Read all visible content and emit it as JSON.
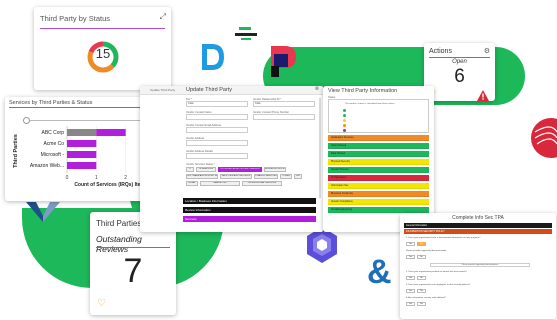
{
  "colors": {
    "brand_green": "#1cb85a",
    "accent_purple": "#b21fdc",
    "rule_purple": "#a64dd9",
    "heart_orange": "#e8a227",
    "warn_red": "#d9283b"
  },
  "status_card": {
    "title": "Third Party by Status",
    "count": "15",
    "expand_icon": "expand-icon"
  },
  "services_card": {
    "title": "Services by Third Parties & Status",
    "chart_data": {
      "type": "bar",
      "orientation": "horizontal",
      "categories": [
        "ABC Corp",
        "Acme Co",
        "Microsoft -",
        "Amazon Web..."
      ],
      "series": [
        {
          "values": [
            1,
            0,
            0,
            0
          ],
          "color": "#888888"
        },
        {
          "values": [
            1,
            1,
            1,
            1
          ],
          "color": "#b21fdc"
        }
      ],
      "xlabel": "Count of Services (IRQs) Items",
      "ylabel": "Third Parties",
      "xticks": [
        "0",
        "1",
        "2",
        "3"
      ],
      "xlim": [
        0,
        3
      ]
    }
  },
  "reviews_card": {
    "title": "Third Parties",
    "subtitle": "Outstanding Reviews",
    "count": "7"
  },
  "actions_card": {
    "title": "Actions",
    "subtitle": "Open",
    "count": "6"
  },
  "form_window": {
    "crumb": "Update Third Party",
    "title": "Update Third Party",
    "fields": [
      {
        "label": "Tier *",
        "value": "Core"
      },
      {
        "label": "Vendor Relationship ID *",
        "value": "Core"
      },
      {
        "label": "Vendor Contact Name",
        "value": ""
      },
      {
        "label": "Vendor Contact Phone Number",
        "value": ""
      },
      {
        "label": "Vendor Contact Email Address",
        "value": ""
      },
      {
        "label": "Vendor Address",
        "value": ""
      },
      {
        "label": "Vendor Address Details",
        "value": ""
      }
    ],
    "services_label": "Vendor Services Status *",
    "chips": [
      "IT",
      "OPERATIONS",
      "OUTSOURCED ACTIVITIES / SERVICE",
      "BUSINESS PROCESS",
      "SOFTWARE AND HOSTED SERVICES",
      "FACILITIES AND GROUNDS",
      "FINANCE SERVICES",
      "OTHER",
      "HR",
      "LEGAL",
      "MARKETING",
      "PROFESSIONAL SERVICES"
    ],
    "sections": [
      "Location / Business Information",
      "Review Information",
      "Services"
    ]
  },
  "info_window": {
    "title": "View Third Party Information",
    "label": "Status",
    "legend_caption": "The vendor's status is calculated from these values",
    "legend_dots": [
      "#1cb85a",
      "#1cb85a",
      "#f2d600",
      "#ff8c00",
      "#d9283b"
    ],
    "status_rows": [
      {
        "label": "Application Services",
        "color": "#f08a24"
      },
      {
        "label": "Cloud Hosted",
        "color": "#1cb85a"
      },
      {
        "label": "Data Hosted",
        "color": "#1cb85a"
      },
      {
        "label": "Physical Security",
        "color": "#f2e600"
      },
      {
        "label": "Vendor Process",
        "color": "#1cb85a"
      },
      {
        "label": "IT Operations",
        "color": "#d9283b"
      },
      {
        "label": "Information Sec",
        "color": "#f2e600"
      },
      {
        "label": "Business Continuity",
        "color": "#f08a24"
      },
      {
        "label": "Vendor Compliance",
        "color": "#f2e600"
      },
      {
        "label": "Social Engineering",
        "color": "#1cb85a"
      }
    ]
  },
  "question_window": {
    "title": "Complete Info Sec TPA",
    "header_1": "General Information",
    "header_2": "INFORMATION SECURITY POLICY",
    "questions": [
      "1. Does your organization have a documented information security program?",
      "Please provide supporting documentation",
      "2. Does your organization perform an annual risk assessment?",
      "3. Does your organization test employees on the security policies?",
      "4. Are information security roles defined?"
    ],
    "note": "Please provide supporting documentation",
    "yes_label": "Yes",
    "no_label": "No"
  }
}
